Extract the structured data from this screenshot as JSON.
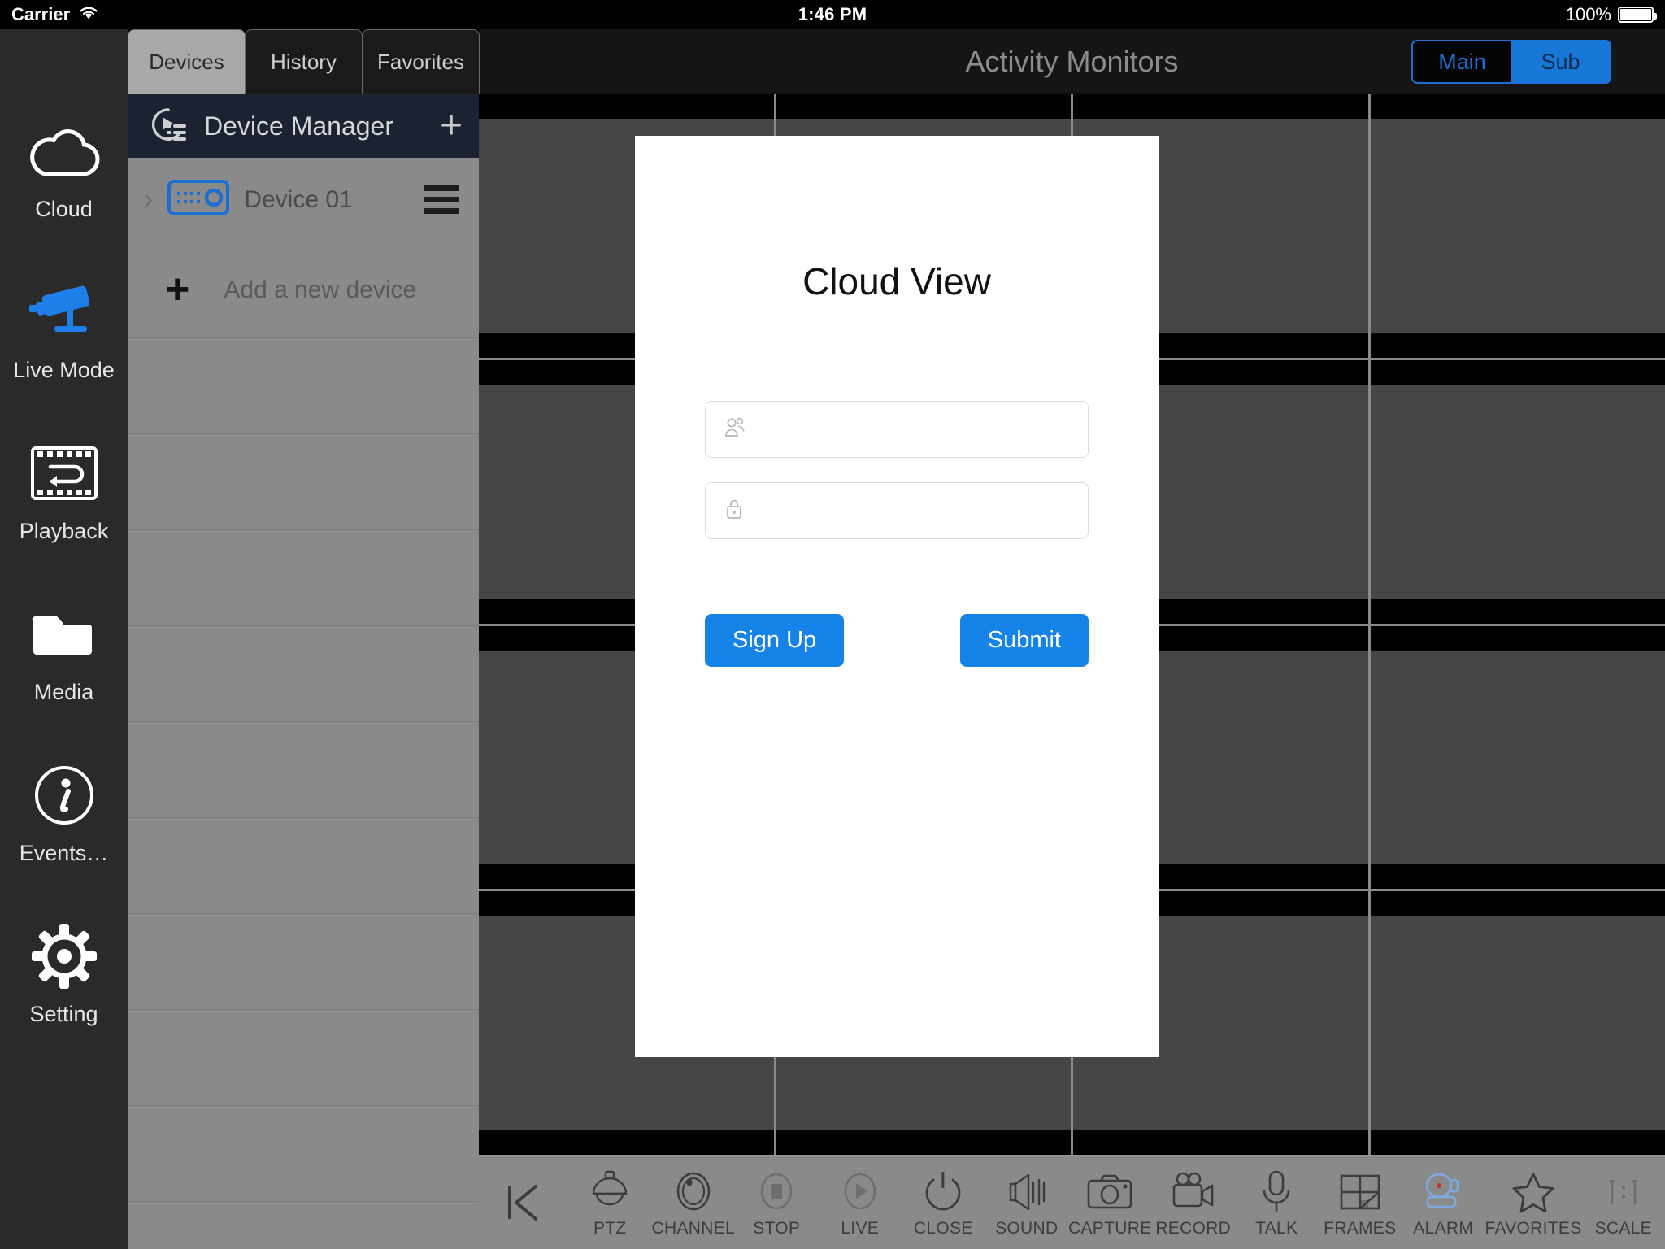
{
  "status_bar": {
    "carrier": "Carrier",
    "wifi_icon": "wifi-icon",
    "time": "1:46 PM",
    "battery_percent": "100%",
    "battery_icon": "battery-full-icon"
  },
  "sidebar": {
    "items": [
      {
        "label": "Cloud",
        "icon": "cloud-icon",
        "active": false
      },
      {
        "label": "Live Mode",
        "icon": "cctv-camera-icon",
        "active": true
      },
      {
        "label": "Playback",
        "icon": "film-reverse-icon",
        "active": false
      },
      {
        "label": "Media",
        "icon": "folder-icon",
        "active": false
      },
      {
        "label": "Events…",
        "icon": "info-circle-icon",
        "active": false
      },
      {
        "label": "Setting",
        "icon": "gear-icon",
        "active": false
      }
    ]
  },
  "tabs": [
    {
      "label": "Devices",
      "active": true
    },
    {
      "label": "History",
      "active": false
    },
    {
      "label": "Favorites",
      "active": false
    }
  ],
  "device_manager": {
    "title": "Device Manager",
    "header_icon": "device-manager-icon",
    "add_icon": "plus-icon",
    "devices": [
      {
        "name": "Device 01",
        "icon": "nvr-box-icon",
        "expander": "chevron-right-icon",
        "menu_icon": "hamburger-menu-icon"
      }
    ],
    "add_row": {
      "label": "Add a new device",
      "icon": "plus-icon"
    },
    "empty_row_count": 9
  },
  "header": {
    "title": "Activity Monitors",
    "stream_toggle": {
      "options": [
        "Main",
        "Sub"
      ],
      "selected": "Sub"
    }
  },
  "video_grid": {
    "columns": 4,
    "rows": 4,
    "cell_count": 16,
    "letterbox_color": "#000000",
    "picture_color": "#464646",
    "gap_color": "#8a8a8a"
  },
  "toolbar": {
    "back_icon": "skip-back-icon",
    "items": [
      {
        "label": "PTZ",
        "icon": "ptz-dome-icon",
        "active": false
      },
      {
        "label": "CHANNEL",
        "icon": "channel-icon",
        "active": false
      },
      {
        "label": "STOP",
        "icon": "stop-icon",
        "active": false
      },
      {
        "label": "LIVE",
        "icon": "play-icon",
        "active": false
      },
      {
        "label": "CLOSE",
        "icon": "power-icon",
        "active": false
      },
      {
        "label": "SOUND",
        "icon": "speaker-icon",
        "active": false
      },
      {
        "label": "CAPTURE",
        "icon": "camera-icon",
        "active": false
      },
      {
        "label": "RECORD",
        "icon": "video-cam-icon",
        "active": false
      },
      {
        "label": "TALK",
        "icon": "microphone-icon",
        "active": false
      },
      {
        "label": "FRAMES",
        "icon": "grid-frames-icon",
        "active": false
      },
      {
        "label": "ALARM",
        "icon": "alarm-cam-icon",
        "active": true
      },
      {
        "label": "FAVORITES",
        "icon": "star-icon",
        "active": false
      },
      {
        "label": "SCALE",
        "icon": "ratio-1-1-icon",
        "active": false
      }
    ]
  },
  "modal": {
    "title": "Cloud View",
    "username_field": {
      "icon": "users-icon",
      "value": "",
      "placeholder": ""
    },
    "password_field": {
      "icon": "lock-icon",
      "value": "",
      "placeholder": ""
    },
    "sign_up_label": "Sign Up",
    "submit_label": "Submit"
  },
  "colors": {
    "accent_blue": "#1683e8",
    "toggle_blue": "#1878d8",
    "rail_bg": "#2a2a2a",
    "panel_gray": "#8a8a8a",
    "dm_header": "#1b2232"
  }
}
